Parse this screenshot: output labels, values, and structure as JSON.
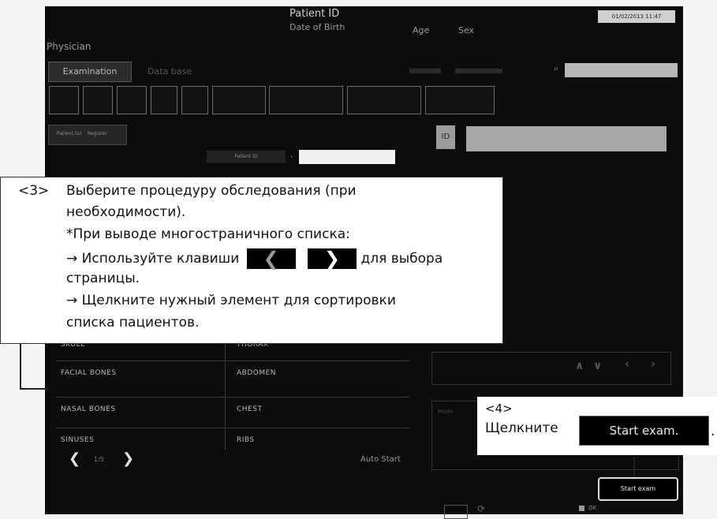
{
  "header": {
    "patient_id_label": "Patient ID",
    "dob_label": "Date of Birth",
    "age_label": "Age",
    "sex_label": "Sex",
    "datetime": "01/02/2013 11:47",
    "physician_label": "Physician"
  },
  "tabs": {
    "examination": "Examination",
    "database": "Data base"
  },
  "subtabs": {
    "patient_list": "Patient list",
    "register": "Register"
  },
  "search": {
    "label": "Patient ID"
  },
  "exam_list": {
    "rows": [
      [
        "SKULL",
        "THORAX"
      ],
      [
        "FACIAL BONES",
        "ABDOMEN"
      ],
      [
        "NASAL BONES",
        "CHEST"
      ],
      [
        "SINUSES",
        "RIBS"
      ]
    ],
    "page": "1/5",
    "auto_start": "Auto Start"
  },
  "right_panel": {
    "start_exam_label": "Start exam",
    "ok_label": "OK"
  },
  "callout3": {
    "num": "<3>",
    "line1": "Выберите процедуру обследования (при",
    "line2": "необходимости).",
    "line3": "*При выводе многостраничного списка:",
    "line4a": "→ Используйте клавиши",
    "line4b": "для выбора",
    "line5": "страницы.",
    "line6": "→ Щелкните нужный элемент для сортировки",
    "line7": "списка пациентов."
  },
  "callout4": {
    "num": "<4>",
    "text": "Щелкните",
    "button": "Start exam.",
    "dot": "."
  }
}
